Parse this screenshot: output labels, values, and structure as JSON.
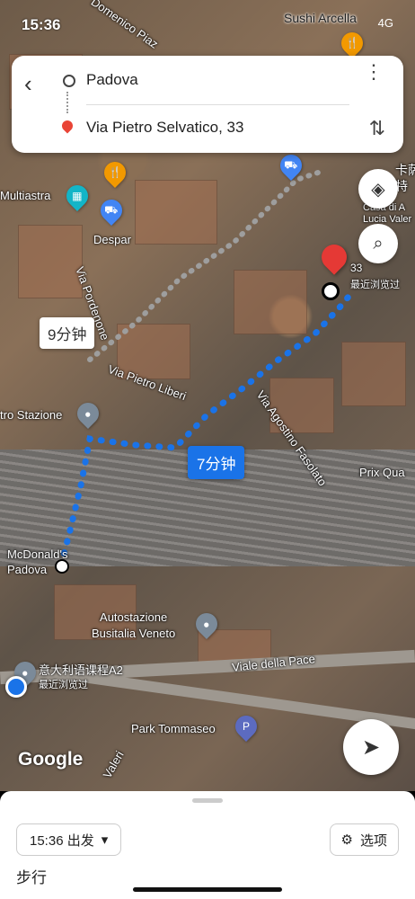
{
  "status": {
    "time": "15:36",
    "network": "4G"
  },
  "directions": {
    "origin": "Padova",
    "destination": "Via Pietro Selvatico, 33"
  },
  "map": {
    "labels": {
      "sushi": "Sushi Arcella",
      "multiastra": "Multiastra",
      "despar": "Despar",
      "via_pordenone": "Via Pordenone",
      "via_pietro_liberi": "Via Pietro Liberi",
      "via_agostino": "Via Agostino Fasolato",
      "stazione": "tro Stazione",
      "mcdonalds": "McDonald's\nPadova",
      "autostazione": "Autostazione\nBusitalia Veneto",
      "viale_pace": "Viale della Pace",
      "italian_course": "意大利语课程A2",
      "recent1": "最近浏览过",
      "recent2": "最近浏览过",
      "park": "Park Tommaseo",
      "prix": "Prix Qua",
      "valeri": "Valeri",
      "casa": "Casa di A\nLucia Valer",
      "num33": "33",
      "via_domenico": "Domenico Piaz",
      "google": "Google",
      "chinese_top": "卡萨\n特"
    },
    "route_bubbles": {
      "gray": "9分钟",
      "blue": "7分钟"
    },
    "colors": {
      "route_blue": "#1a73e8",
      "route_gray": "#9e9e9e",
      "dest_red": "#e53935"
    }
  },
  "sheet": {
    "depart_label": "15:36 出发",
    "options_label": "选项",
    "mode": "步行"
  },
  "icons": {
    "back": "back-icon",
    "more": "more-vert-icon",
    "swap": "swap-icon",
    "layers": "layers-icon",
    "search": "search-icon",
    "locate": "navigation-icon"
  }
}
